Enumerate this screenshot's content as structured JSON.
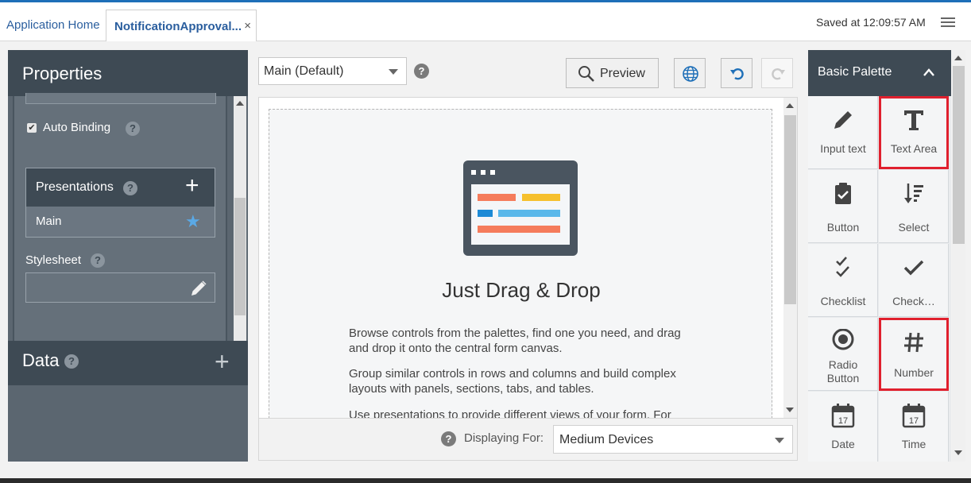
{
  "tabs": {
    "home_label": "Application Home",
    "active_label": "NotificationApproval...",
    "close_glyph": "×"
  },
  "status": {
    "saved_text": "Saved at 12:09:57 AM"
  },
  "properties": {
    "title": "Properties",
    "auto_binding_label": "Auto Binding",
    "auto_binding_checked": true,
    "presentations_title": "Presentations",
    "presentation_item": "Main",
    "stylesheet_label": "Stylesheet",
    "stylesheet_value": ""
  },
  "data_section": {
    "title": "Data"
  },
  "toolbar": {
    "presentation_select": "Main (Default)",
    "preview_label": "Preview"
  },
  "canvas": {
    "heading": "Just Drag & Drop",
    "paragraphs": [
      "Browse controls from the palettes, find one you need, and drag and drop it onto the central form canvas.",
      "Group similar controls in rows and columns and build complex layouts with panels, sections, tabs, and tables.",
      "Use presentations to provide different views of your form. For"
    ],
    "illustration_colors": {
      "frame": "#4a5560",
      "orange": "#f57c5c",
      "yellow": "#f6c02d",
      "blue": "#1c8ad6",
      "lightblue": "#5ab8ea"
    }
  },
  "footer": {
    "displaying_label": "Displaying For:",
    "device_select": "Medium Devices"
  },
  "palette": {
    "title": "Basic Palette",
    "items": [
      {
        "label": "Input text",
        "icon": "pencil-icon",
        "highlighted": false
      },
      {
        "label": "Text Area",
        "icon": "text-t-icon",
        "highlighted": true
      },
      {
        "label": "Button",
        "icon": "clipboard-check-icon",
        "highlighted": false
      },
      {
        "label": "Select",
        "icon": "sort-list-icon",
        "highlighted": false
      },
      {
        "label": "Checklist",
        "icon": "double-check-icon",
        "highlighted": false
      },
      {
        "label": "Check…",
        "icon": "check-icon",
        "highlighted": false
      },
      {
        "label": "Radio Button",
        "icon": "radio-icon",
        "highlighted": false
      },
      {
        "label": "Number",
        "icon": "hash-icon",
        "highlighted": true
      },
      {
        "label": "Date",
        "icon": "calendar-icon",
        "highlighted": false
      },
      {
        "label": "Time",
        "icon": "calendar-time-icon",
        "highlighted": false
      }
    ],
    "calendar_number": "17"
  },
  "colors": {
    "accent": "#2a5e9e",
    "panel_dark": "#3e4a54",
    "highlight": "#e0202e"
  }
}
